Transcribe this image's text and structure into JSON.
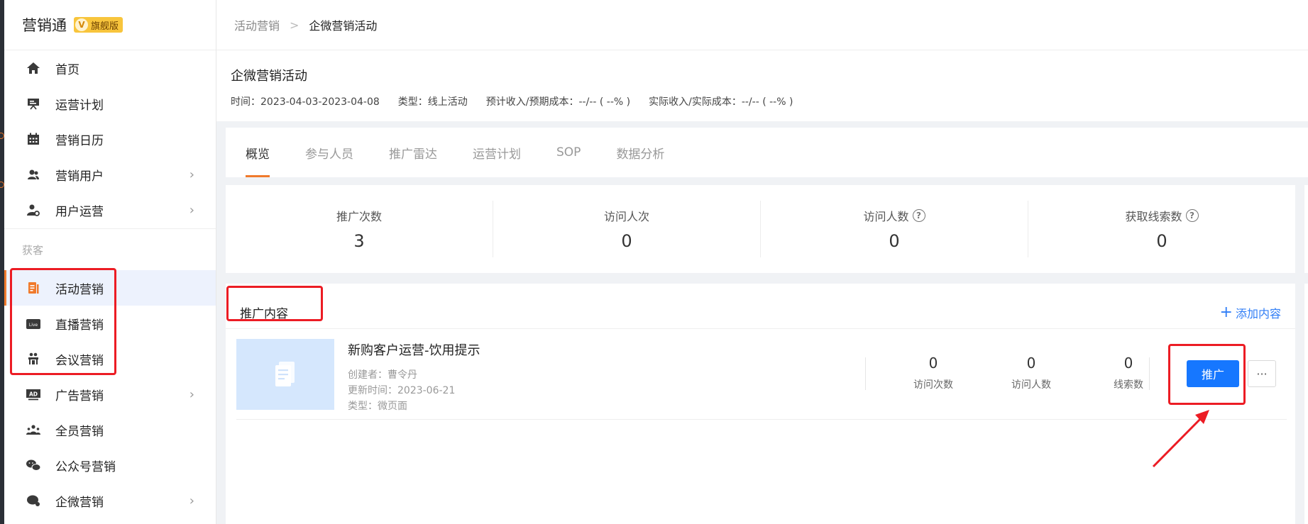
{
  "brand": {
    "name": "营销通",
    "badge_v": "V",
    "badge_text": "旗舰版"
  },
  "sidebar": {
    "items_top": [
      {
        "label": "首页",
        "icon": "home-icon"
      },
      {
        "label": "运营计划",
        "icon": "presentation-icon"
      },
      {
        "label": "营销日历",
        "icon": "calendar-icon"
      },
      {
        "label": "营销用户",
        "icon": "users-icon",
        "chevron": true
      },
      {
        "label": "用户运营",
        "icon": "user-settings-icon",
        "chevron": true
      }
    ],
    "group_label": "获客",
    "items_bottom": [
      {
        "label": "活动营销",
        "icon": "activity-icon",
        "active": true
      },
      {
        "label": "直播营销",
        "icon": "live-icon",
        "icon_text": "Live"
      },
      {
        "label": "会议营销",
        "icon": "meeting-icon"
      },
      {
        "label": "广告营销",
        "icon": "ad-icon",
        "icon_text": "AD",
        "chevron": true
      },
      {
        "label": "全员营销",
        "icon": "team-icon"
      },
      {
        "label": "公众号营销",
        "icon": "wechat-icon"
      },
      {
        "label": "企微营销",
        "icon": "chat-icon",
        "chevron": true
      }
    ]
  },
  "breadcrumb": {
    "parent": "活动营销",
    "separator": ">",
    "current": "企微营销活动"
  },
  "header": {
    "title": "企微营销活动",
    "time": "时间：2023-04-03-2023-04-08",
    "type": "类型：线上活动",
    "expected": "预计收入/预期成本：--/-- ( --% )",
    "actual": "实际收入/实际成本：--/-- ( --% )"
  },
  "tabs": [
    {
      "label": "概览",
      "active": true
    },
    {
      "label": "参与人员"
    },
    {
      "label": "推广雷达"
    },
    {
      "label": "运营计划"
    },
    {
      "label": "SOP"
    },
    {
      "label": "数据分析"
    }
  ],
  "stats": [
    {
      "label": "推广次数",
      "value": "3",
      "help": false
    },
    {
      "label": "访问人次",
      "value": "0",
      "help": false
    },
    {
      "label": "访问人数",
      "value": "0",
      "help": true
    },
    {
      "label": "获取线索数",
      "value": "0",
      "help": true
    }
  ],
  "content": {
    "heading": "推广内容",
    "add_label": "添加内容",
    "item": {
      "title": "新购客户运营-饮用提示",
      "creator": "创建者：曹令丹",
      "updated": "更新时间：2023-06-21",
      "type": "类型：微页面",
      "metrics": [
        {
          "value": "0",
          "label": "访问次数"
        },
        {
          "value": "0",
          "label": "访问人数"
        },
        {
          "value": "0",
          "label": "线索数"
        }
      ],
      "promote_label": "推广",
      "more_label": "···"
    }
  },
  "colors": {
    "accent": "#f07a2c",
    "primary": "#1677ff",
    "highlight": "#ec1c24"
  }
}
